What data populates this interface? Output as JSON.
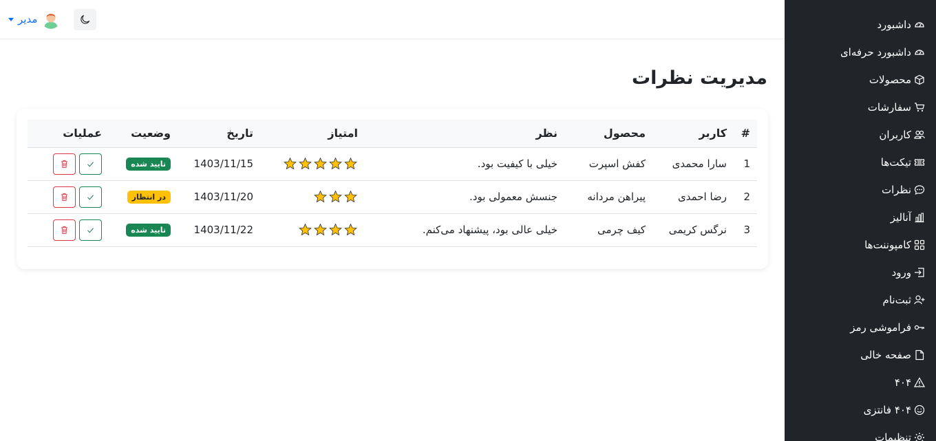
{
  "user": {
    "name": "مدیر"
  },
  "page": {
    "title": "مدیریت نظرات"
  },
  "sidebar": {
    "items": [
      {
        "label": "داشبورد",
        "icon": "speedometer-icon"
      },
      {
        "label": "داشبورد حرفه‌ای",
        "icon": "speedometer-icon"
      },
      {
        "label": "محصولات",
        "icon": "box-icon"
      },
      {
        "label": "سفارشات",
        "icon": "cart-icon"
      },
      {
        "label": "کاربران",
        "icon": "people-icon"
      },
      {
        "label": "تیکت‌ها",
        "icon": "ticket-icon"
      },
      {
        "label": "نظرات",
        "icon": "chat-icon"
      },
      {
        "label": "آنالیز",
        "icon": "bar-chart-icon"
      },
      {
        "label": "کامپوننت‌ها",
        "icon": "grid-icon"
      },
      {
        "label": "ورود",
        "icon": "login-icon"
      },
      {
        "label": "ثبت‌نام",
        "icon": "person-add-icon"
      },
      {
        "label": "فراموشی رمز",
        "icon": "key-icon"
      },
      {
        "label": "صفحه خالی",
        "icon": "file-icon"
      },
      {
        "label": "۴۰۴",
        "icon": "warning-icon"
      },
      {
        "label": "۴۰۴ فانتزی",
        "icon": "smile-icon"
      },
      {
        "label": "تنظیمات",
        "icon": "gear-icon"
      }
    ]
  },
  "table": {
    "headers": [
      "#",
      "کاربر",
      "محصول",
      "نظر",
      "امتیاز",
      "تاریخ",
      "وضعیت",
      "عملیات"
    ],
    "rows": [
      {
        "idx": "1",
        "user": "سارا محمدی",
        "product": "کفش اسپرت",
        "comment": "خیلی با کیفیت بود.",
        "rating": 5,
        "date": "1403/11/15",
        "status": "تایید شده",
        "status_type": "approved"
      },
      {
        "idx": "2",
        "user": "رضا احمدی",
        "product": "پیراهن مردانه",
        "comment": "جنسش معمولی بود.",
        "rating": 3,
        "date": "1403/11/20",
        "status": "در انتظار",
        "status_type": "pending"
      },
      {
        "idx": "3",
        "user": "نرگس کریمی",
        "product": "کیف چرمی",
        "comment": "خیلی عالی بود، پیشنهاد می‌کنم.",
        "rating": 4,
        "date": "1403/11/22",
        "status": "تایید شده",
        "status_type": "approved"
      }
    ]
  },
  "colors": {
    "sidebar_bg": "#212529",
    "accent": "#0d6efd",
    "success": "#198754",
    "warning": "#ffc107",
    "danger": "#dc3545",
    "star": "#ffc107"
  }
}
